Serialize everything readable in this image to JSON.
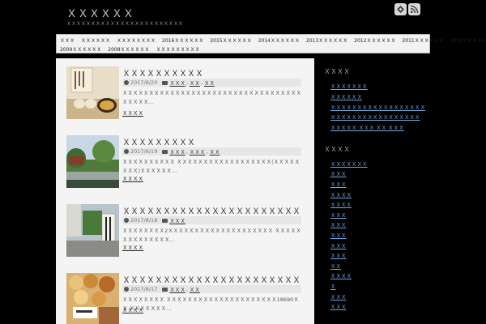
{
  "site": {
    "title": "ＸＸＸＸＸＸ",
    "description": "ＸＸＸＸＸＸＸＸＸＸＸＸＸＸＸＸＸＸＸＸＸＸＸＸ",
    "header_icons": [
      "feedly-icon",
      "rss-icon"
    ]
  },
  "nav": {
    "row1": [
      "ＸＸＸ",
      "ＸＸＸＸＸＸ",
      "ＸＸＸＸＸＸＸＸ",
      "2016ＸＸＸＸＸＸ",
      "2015ＸＸＸＸＸＸ",
      "2014ＸＸＸＸＸＸ",
      "2013ＸＸＸＸＸＸ",
      "2012ＸＸＸＸＸＸ",
      "2011ＸＸＸＸＸＸ",
      "2010ＸＸＸＸＸＸ"
    ],
    "row2": [
      "2009ＸＸＸＸＸＸ",
      "2008ＸＸＸＸＸＸ",
      "ＸＸＸＸＸＸＸＸＸ"
    ]
  },
  "posts": [
    {
      "title": "ＸＸＸＸＸＸＸＸＸＸ",
      "date": "2017/8/20",
      "categories": [
        "ＸＸＸ",
        "ＸＸ",
        "ＸＸ"
      ],
      "excerpt": "ＸＸＸＸＸＸＸＸＸＸＸＸＸＸＸＸＸＸＸＸＸＸＸＸＸＸＸＸＸＸＸＸＸＸ ＸＸＸＸＸ…",
      "read_more": "ＸＸＸＸ"
    },
    {
      "title": "ＸＸＸＸＸＸＸＸＸ",
      "date": "2017/8/19",
      "categories": [
        "ＸＸＸ",
        "ＸＸＸ",
        "ＸＸ"
      ],
      "excerpt": "ＸＸＸＸＸＸＸＸＸＸ ＸＸＸＸＸＸＸＸＸＸＸＸＸＸＸＸＸＸ(ＸＸＸＸＸＸＸＸ)ＸＸＸＸＸＸ…",
      "read_more": "ＸＸＸＸ"
    },
    {
      "title": "ＸＸＸＸＸＸＸＸＸＸＸＸＸＸＸＸＸＸＸＸＸＸ",
      "date": "2017/8/18",
      "categories": [
        "ＸＸＸ"
      ],
      "excerpt": "ＸＸＸＸＸＸＸＸ2ＸＸＸＸＸＸＸＸＸＸＸＸＸＸＸＸＸＸＸＸ ＸＸＸＸＸＸＸＸＸＸＸＸＸＸ…",
      "read_more": "ＸＸＸＸ"
    },
    {
      "title": "ＸＸＸＸＸＸＸＸＸＸＸＸＸＸＸＸＸＸＸＸＸＸ",
      "date": "2017/8/17",
      "categories": [
        "ＸＸＸ",
        "ＸＸ"
      ],
      "excerpt": "ＸＸＸＸＸＸＸＸ ＸＸＸＸＸＸＸＸＸＸＸＸＸＸＸＸＸＸＸＸＸ18690ＸＸ ＸＸＸＸＸＸＸ…",
      "read_more": "ＸＸＸＸ"
    }
  ],
  "sidebar": {
    "widget1_title": "ＸＸＸＸ",
    "widget1_links": [
      "ＸＸＸＸＸＸＸ",
      "ＸＸＸＸＸＸ",
      "ＸＸＸＸＸＸＸＸＸＸＸＸＸＸＸＸＸＸ",
      "ＸＸＸＸＸＸＸＸＸＸＸＸＸＸＸＸＸ",
      "ＸＸＸＸＸ ＸＸＸ ＸＸ ＸＸＸ"
    ],
    "widget2_title": "ＸＸＸＸ",
    "widget2_links": [
      "ＸＸＸＸＸＸＸ",
      "ＸＸＸ",
      "ＸＸＸ",
      "ＸＸＸＸ",
      "ＸＸＸＸ",
      "ＸＸＸ",
      "ＸＸＸ",
      "ＸＸＸ",
      "ＸＸＸ",
      "ＸＸＸ",
      "ＸＸ",
      "ＸＸＸＸ",
      "Ｘ",
      "ＸＸＸ",
      "ＸＸＸ"
    ]
  },
  "colors": {
    "background": "#000000",
    "content_bg": "#f4f4f4",
    "nav_bg": "#f2f2f2",
    "sidebar_link": "#6fa8dc"
  }
}
